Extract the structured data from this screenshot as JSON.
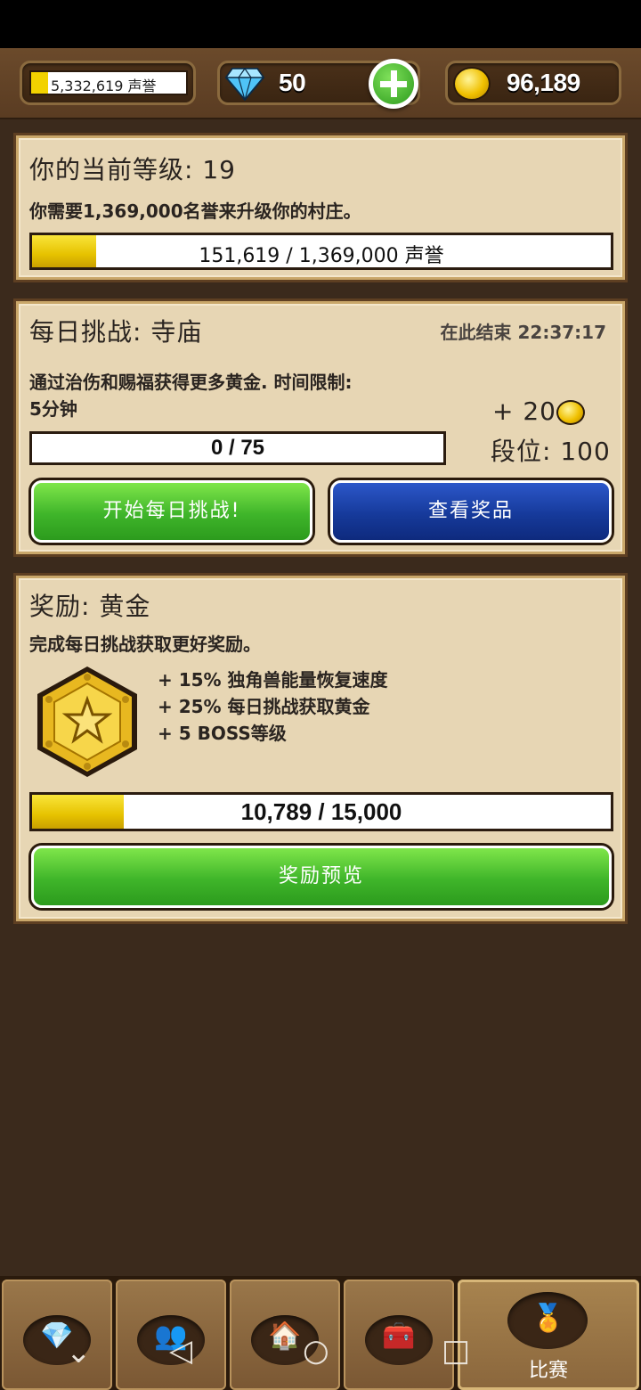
{
  "top_bar": {
    "fame_text": "5,332,619 声誉",
    "fame_fill_fraction": 0.11,
    "gems": "50",
    "gold": "96,189"
  },
  "level_panel": {
    "title": "你的当前等级: 19",
    "subtitle": "你需要1,369,000名誉来升级你的村庄。",
    "progress_text": "151,619 / 1,369,000 声誉",
    "progress_fraction": 0.111
  },
  "challenge_panel": {
    "title": "每日挑战: 寺庙",
    "ends_text": "在此结束 22:37:17",
    "description_line1": "通过治伤和赐福获得更多黄金. 时间限制:",
    "description_line2": "5分钟",
    "reward_amount": "+ 20",
    "rank_text": "段位: 100",
    "progress_text": "0 / 75",
    "progress_fraction": 0,
    "start_button": "开始每日挑战!",
    "view_prizes_button": "查看奖品"
  },
  "reward_panel": {
    "title": "奖励: 黄金",
    "subtitle": "完成每日挑战获取更好奖励。",
    "bonuses": [
      "+ 15% 独角兽能量恢复速度",
      "+ 25% 每日挑战获取黄金",
      "+ 5 BOSS等级"
    ],
    "progress_text": "10,789 / 15,000",
    "progress_fraction": 0.158,
    "preview_button": "奖励预览"
  },
  "bottom_nav": {
    "tabs": [
      {
        "icon": "gem-icon"
      },
      {
        "icon": "people-icon"
      },
      {
        "icon": "house-icon"
      },
      {
        "icon": "chest-icon"
      },
      {
        "icon": "medal-icon",
        "label": "比赛"
      }
    ]
  },
  "colors": {
    "background": "#3b2a1c",
    "panel": "#e7d6b4",
    "progress_yellow": "#f2d200",
    "green_button": "#3fb52a",
    "blue_button": "#163a9b"
  }
}
